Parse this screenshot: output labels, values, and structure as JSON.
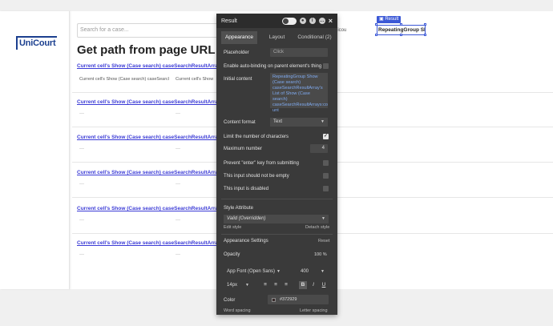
{
  "canvas": {
    "logo": "UniCourt",
    "search_placeholder": "Search for a case...",
    "page_title": "Get path from page URL",
    "rows": [
      {
        "link": "Current cell's Show (Case search) caseSearchResultArray's",
        "sub1": "Current cell's Show (Case search) caseSearcl",
        "sub2": "Current cell's Show"
      },
      {
        "link": "Current cell's Show (Case search) caseSearchResultArray's",
        "sub1": "—",
        "sub2": "—"
      },
      {
        "link": "Current cell's Show (Case search) caseSearchResultArray's",
        "sub1": "—",
        "sub2": "—"
      },
      {
        "link": "Current cell's Show (Case search) caseSearchResultArray's",
        "sub1": "—",
        "sub2": "—"
      },
      {
        "link": "Current cell's Show (Case search) caseSearchResultArray's",
        "sub1": "—",
        "sub2": "—"
      },
      {
        "link": "Current cell's Show (Case search) caseSearchResultArray's",
        "sub1": "—",
        "sub2": "—"
      }
    ],
    "right_text": "nicou",
    "selected_badge": "Result",
    "selected_text": "RepeatingGroup Sh"
  },
  "editor": {
    "title": "Result",
    "tabs": [
      "Appearance",
      "Layout",
      "Conditional (2)"
    ],
    "placeholder_label": "Placeholder",
    "placeholder_value": "Click",
    "autobind_label": "Enable auto-binding on parent element's thing",
    "initial_content_label": "Initial content",
    "initial_content_value": "RepeatingGroup Show (Case search) caseSearchResultArray's List of Show (Case search) caseSearchResultArrays:co unt",
    "content_format_label": "Content format",
    "content_format_value": "Text",
    "limit_label": "Limit the number of characters",
    "max_label": "Maximum number",
    "max_value": "4",
    "prevent_enter_label": "Prevent \"enter\" key from submitting",
    "not_empty_label": "This input should not be empty",
    "disabled_label": "This input is disabled",
    "style_attr_label": "Style Attribute",
    "style_value": "Valid (Overridden)",
    "edit_style": "Edit style",
    "detach_style": "Detach style",
    "appearance_settings": "Appearance Settings",
    "reset": "Reset",
    "opacity_label": "Opacity",
    "opacity_value": "100",
    "opacity_unit": "%",
    "font_value": "App Font (Open Sans)",
    "weight_value": "400",
    "size_value": "14px",
    "color_label": "Color",
    "color_value": "#372929",
    "word_spacing": "Word spacing",
    "letter_spacing": "Letter spacing",
    "limit_checked": true
  }
}
